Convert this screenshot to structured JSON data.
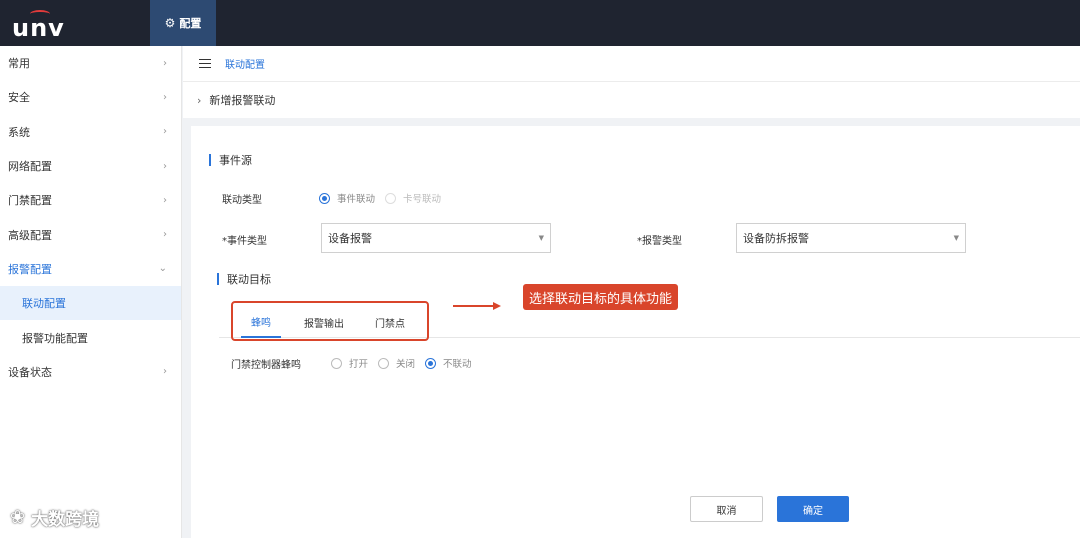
{
  "brand": {
    "logo_text": "unv",
    "accent": "#2a74d9",
    "topbar_bg": "#1f2430",
    "highlight": "#d9452b"
  },
  "topnav": {
    "config_label": "配置",
    "config_icon": "gear-icon"
  },
  "sidebar": {
    "items": [
      {
        "label": "常用"
      },
      {
        "label": "安全"
      },
      {
        "label": "系统"
      },
      {
        "label": "网络配置"
      },
      {
        "label": "门禁配置"
      },
      {
        "label": "高级配置"
      },
      {
        "label": "报警配置"
      },
      {
        "label": "联动配置"
      },
      {
        "label": "报警功能配置"
      },
      {
        "label": "设备状态"
      }
    ]
  },
  "breadcrumb": {
    "current": "联动配置"
  },
  "subheader": {
    "title": "新增报警联动"
  },
  "form": {
    "event_source_title": "事件源",
    "linkage_type_label": "联动类型",
    "linkage_type_options": [
      "事件联动",
      "卡号联动"
    ],
    "event_type_label": "*事件类型",
    "event_type_value": "设备报警",
    "alarm_type_label": "*报警类型",
    "alarm_type_value": "设备防拆报警",
    "linkage_target_title": "联动目标",
    "tabs": [
      "蜂鸣",
      "报警输出",
      "门禁点"
    ],
    "buzzer_label": "门禁控制器蜂鸣",
    "buzzer_options": [
      "打开",
      "关闭",
      "不联动"
    ]
  },
  "annotation": {
    "callout_text": "选择联动目标的具体功能"
  },
  "buttons": {
    "cancel": "取消",
    "ok": "确定"
  },
  "watermark": {
    "text": "大数跨境"
  }
}
